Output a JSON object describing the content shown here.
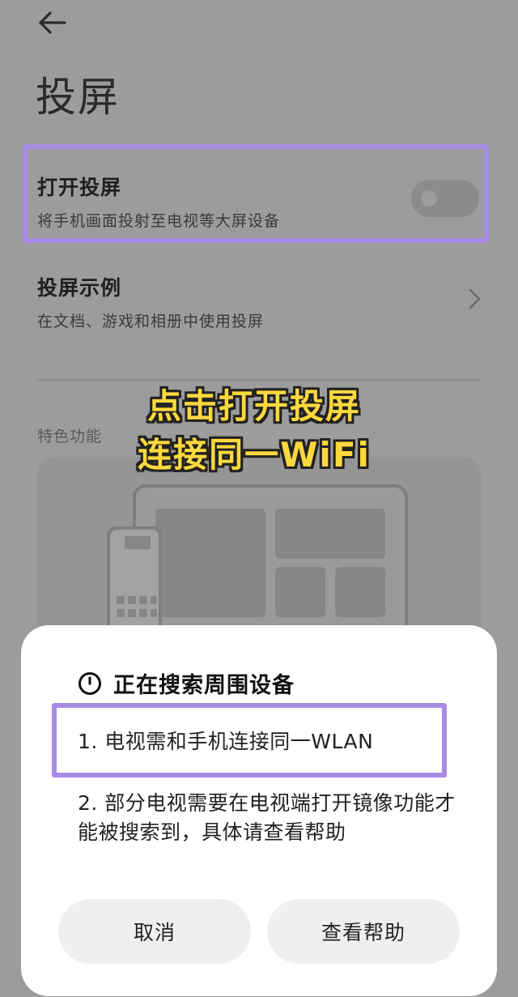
{
  "header": {
    "back_icon": "arrow-left-icon",
    "title": "投屏"
  },
  "settings": {
    "cast_toggle": {
      "title": "打开投屏",
      "subtitle": "将手机画面投射至电视等大屏设备",
      "enabled": false
    },
    "cast_examples": {
      "title": "投屏示例",
      "subtitle": "在文档、游戏和相册中使用投屏",
      "chevron_icon": "chevron-right-icon"
    },
    "features_label": "特色功能"
  },
  "overlay_caption": {
    "line1": "点击打开投屏",
    "line2": "连接同一WiFi"
  },
  "sheet": {
    "icon": "spinner-icon",
    "title": "正在搜索周围设备",
    "tips": [
      "1. 电视需和手机连接同一WLAN",
      "2. 部分电视需要在电视端打开镜像功能才能被搜索到，具体请查看帮助"
    ],
    "cancel_label": "取消",
    "help_label": "查看帮助"
  },
  "colors": {
    "highlight": "#a98be6",
    "caption": "#ffd93d",
    "dim_background": "#9c9c9c"
  }
}
